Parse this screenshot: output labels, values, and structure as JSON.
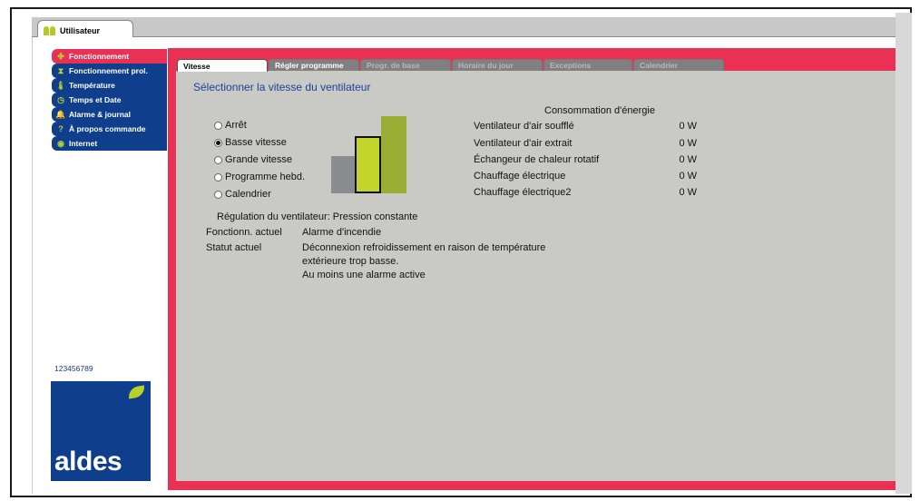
{
  "window": {
    "user_tab": "Utilisateur"
  },
  "sidebar": {
    "items": [
      {
        "label": "Fonctionnement",
        "icon": "fan-icon"
      },
      {
        "label": "Fonctionnement prol.",
        "icon": "hourglass-icon"
      },
      {
        "label": "Température",
        "icon": "thermometer-icon"
      },
      {
        "label": "Temps et Date",
        "icon": "clock-icon"
      },
      {
        "label": "Alarme & journal",
        "icon": "bell-icon"
      },
      {
        "label": "À propos commande",
        "icon": "question-icon"
      },
      {
        "label": "Internet",
        "icon": "globe-icon"
      }
    ],
    "serial": "123456789",
    "logo": "aldes"
  },
  "tabs": [
    {
      "label": "Vitesse",
      "state": "active"
    },
    {
      "label": "Régler programme",
      "state": "enabled"
    },
    {
      "label": "Progr. de base",
      "state": "disabled"
    },
    {
      "label": "Horaire du jour",
      "state": "disabled"
    },
    {
      "label": "Exceptions",
      "state": "disabled"
    },
    {
      "label": "Calendrier",
      "state": "disabled"
    }
  ],
  "main": {
    "heading": "Sélectionner la vitesse du ventilateur",
    "speed_options": [
      {
        "label": "Arrêt",
        "checked": false
      },
      {
        "label": "Basse vitesse",
        "checked": true
      },
      {
        "label": "Grande vitesse",
        "checked": false
      },
      {
        "label": "Programme hebd.",
        "checked": false
      },
      {
        "label": "Calendrier",
        "checked": false
      }
    ],
    "speed_indicator": {
      "levels": 3,
      "selected": 2,
      "colors": [
        "#8a8d8f",
        "#c3d42a",
        "#9aad35"
      ]
    },
    "regulation": "Régulation du ventilateur: Pression constante",
    "current_operation_label": "Fonctionn. actuel",
    "current_operation_value": "Alarme d'incendie",
    "current_status_label": "Statut actuel",
    "current_status_lines": [
      "Déconnexion refroidissement en raison de température",
      "extérieure trop basse.",
      "Au moins une alarme active"
    ]
  },
  "energy": {
    "title": "Consommation d'énergie",
    "rows": [
      {
        "label": "Ventilateur d'air soufflé",
        "value": "0 W"
      },
      {
        "label": "Ventilateur d'air extrait",
        "value": "0 W"
      },
      {
        "label": "Échangeur de chaleur rotatif",
        "value": "0 W"
      },
      {
        "label": "Chauffage électrique",
        "value": "0 W"
      },
      {
        "label": "Chauffage électrique2",
        "value": "0 W"
      }
    ]
  },
  "colors": {
    "accent": "#e83155",
    "nav": "#0f3f8c",
    "panel": "#c9cac5",
    "heading": "#1d3f98"
  }
}
